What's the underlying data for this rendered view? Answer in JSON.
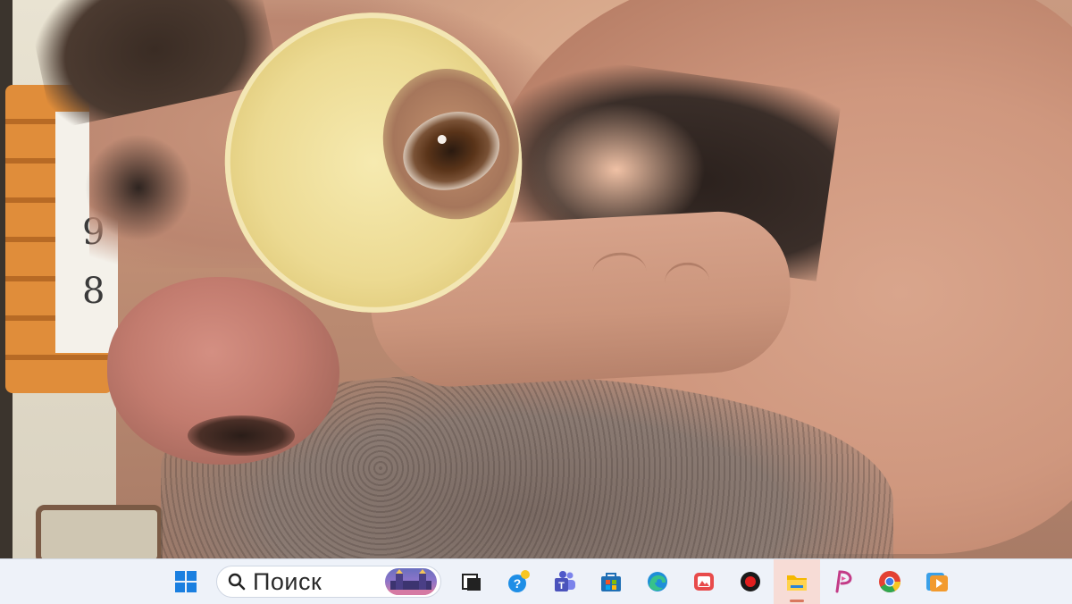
{
  "desktop": {
    "photo_alt": "",
    "clock_numbers": [
      "9",
      "8"
    ]
  },
  "taskbar": {
    "start_icon": "windows-start-icon",
    "search": {
      "icon": "search-icon",
      "placeholder": "Поиск"
    },
    "apps": [
      {
        "name": "task-view",
        "icon": "task-view-icon"
      },
      {
        "name": "help",
        "icon": "help-icon"
      },
      {
        "name": "teams",
        "icon": "teams-icon"
      },
      {
        "name": "store",
        "icon": "microsoft-store-icon"
      },
      {
        "name": "edge",
        "icon": "edge-browser-icon"
      },
      {
        "name": "photos",
        "icon": "photos-icon"
      },
      {
        "name": "recorder",
        "icon": "record-icon"
      },
      {
        "name": "file-explorer",
        "icon": "folder-icon",
        "active": true
      },
      {
        "name": "media-app",
        "icon": "play-p-icon"
      },
      {
        "name": "chrome",
        "icon": "chrome-icon"
      },
      {
        "name": "video-player",
        "icon": "video-player-icon"
      }
    ],
    "colors": {
      "windows_blue": "#1a7fe0",
      "help_badge": "#f7c623",
      "chrome_red": "#e34133",
      "chrome_yellow": "#f7c623",
      "chrome_green": "#2fa84f",
      "chrome_blue": "#3d7be6",
      "active_highlight": "#f7dcd6"
    }
  }
}
